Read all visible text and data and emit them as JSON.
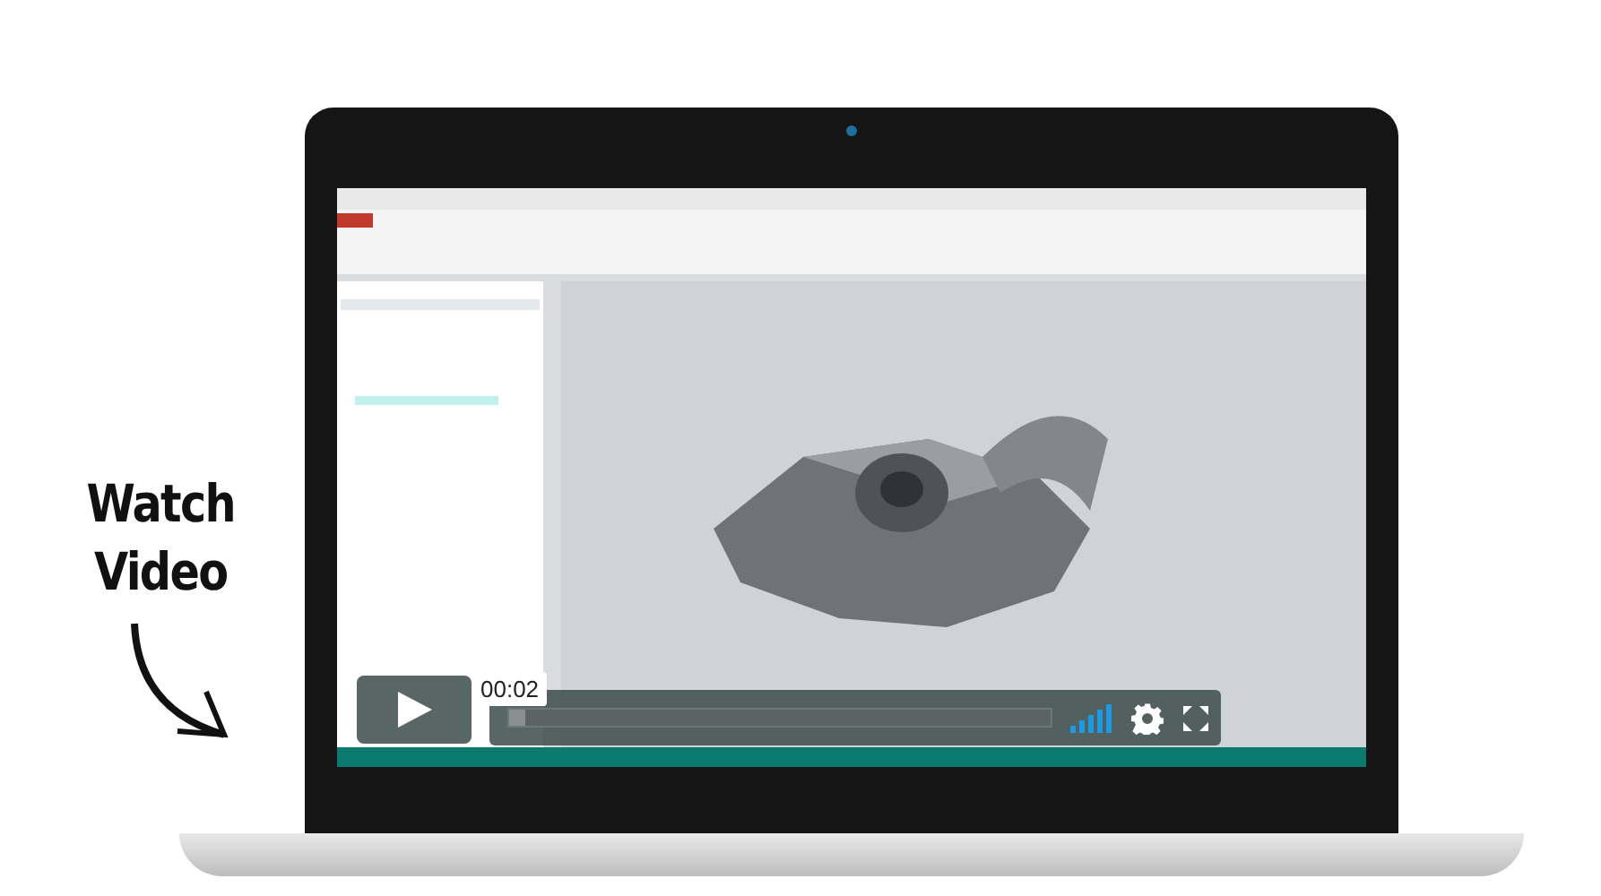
{
  "promo": {
    "lines": [
      "Watch",
      "Video"
    ]
  },
  "video": {
    "kind": "picture",
    "time": "00:02",
    "progress": {
      "level": 0.03
    }
  }
}
